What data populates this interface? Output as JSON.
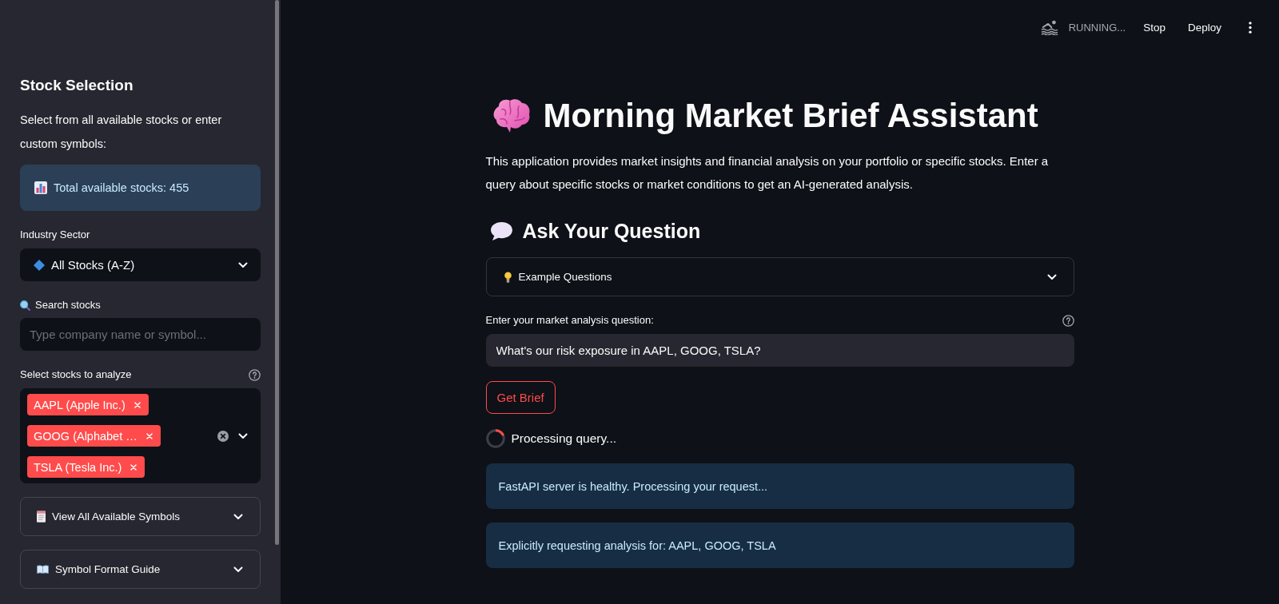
{
  "header": {
    "status": "RUNNING...",
    "buttons": [
      "Stop",
      "Deploy"
    ]
  },
  "sidebar": {
    "title": "Stock Selection",
    "description": "Select from all available stocks or enter custom symbols:",
    "info": "Total available stocks: 455",
    "sector_select": {
      "label": "Industry Sector",
      "value": "All Stocks (A-Z)"
    },
    "search": {
      "label": "Search stocks",
      "placeholder": "Type company name or symbol..."
    },
    "stock_select": {
      "label": "Select stocks to analyze",
      "tags": [
        "AAPL (Apple Inc.)",
        "GOOG (Alphabet …",
        "TSLA (Tesla Inc.)"
      ]
    },
    "expanders": [
      {
        "label": "View All Available Symbols",
        "expanded": false
      },
      {
        "label": "Symbol Format Guide",
        "expanded": false
      }
    ]
  },
  "main": {
    "title": "Morning Market Brief Assistant",
    "intro": "This application provides market insights and financial analysis on your portfolio or specific stocks. Enter a query about specific stocks or market conditions to get an AI-generated analysis.",
    "section_heading": "Ask Your Question",
    "examples_expander": {
      "label": "Example Questions",
      "expanded": false
    },
    "question": {
      "label": "Enter your market analysis question:",
      "value": "What's our risk exposure in AAPL, GOOG, TSLA?"
    },
    "submit_button": "Get Brief",
    "spinner": "Processing query...",
    "messages": [
      "FastAPI server is healthy. Processing your request...",
      "Explicitly requesting analysis for: AAPL, GOOG, TSLA"
    ]
  }
}
